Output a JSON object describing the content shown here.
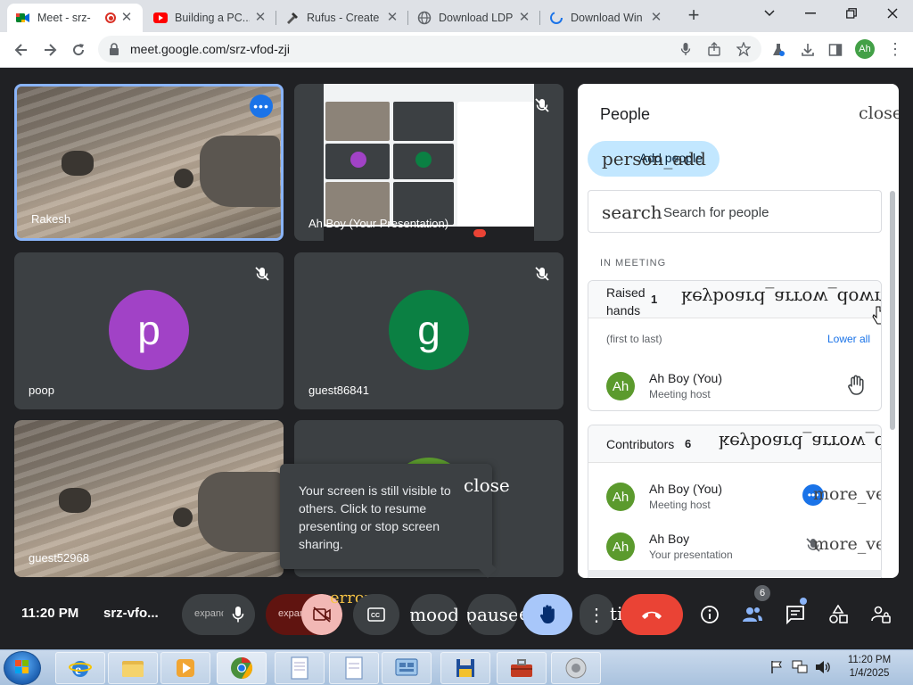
{
  "browser": {
    "tabs": [
      {
        "title": "Meet - srz-",
        "active": true
      },
      {
        "title": "Building a PC..."
      },
      {
        "title": "Rufus - Create"
      },
      {
        "title": "Download LDP"
      },
      {
        "title": "Download Win"
      }
    ],
    "url": "meet.google.com/srz-vfod-zji",
    "profile_initials": "Ah"
  },
  "tiles": {
    "rakesh": {
      "name": "Rakesh"
    },
    "presentation": {
      "name": "Ah Boy (Your Presentation)"
    },
    "poop": {
      "name": "poop",
      "initial": "p",
      "color": "#a142c6"
    },
    "guest86841": {
      "name": "guest86841",
      "initial": "g",
      "color": "#0b8043"
    },
    "guest52968": {
      "name": "guest52968"
    }
  },
  "toast": {
    "text": "Your screen is still visible to others. Click to resume presenting or stop screen sharing.",
    "close_glyph": "close"
  },
  "people_panel": {
    "title": "People",
    "close_glyph": "close",
    "add_icon": "person_add",
    "add_label": "Add people",
    "search_icon": "search",
    "search_placeholder": "Search for people",
    "section": "IN MEETING",
    "raised_hands": {
      "title_line1": "Raised",
      "title_line2": "hands",
      "count": "1",
      "chevron": "keyboard_arrow_down",
      "order_hint": "(first to last)",
      "lower_all": "Lower all",
      "person": {
        "initials": "Ah",
        "name": "Ah Boy (You)",
        "role": "Meeting host"
      }
    },
    "contributors": {
      "title": "Contributors",
      "count": "6",
      "chevron": "keyboard_arrow_down",
      "people": [
        {
          "initials": "Ah",
          "name": "Ah Boy (You)",
          "role": "Meeting host",
          "action": "more_vert"
        },
        {
          "initials": "Ah",
          "name": "Ah Boy",
          "role": "Your presentation",
          "action": "more_vert"
        }
      ]
    }
  },
  "controls": {
    "time": "11:20 PM",
    "meeting_code": "srz-vfo...",
    "mic_expand": "expand_less",
    "cam_expand": "expand_less",
    "cam_error": "error",
    "reactions": "mood",
    "present": "pause",
    "more_text": "ti",
    "people_badge": "6",
    "present_text": "e"
  },
  "taskbar": {
    "time": "11:20 PM",
    "date": "1/4/2025"
  },
  "colors": {
    "meet_bg": "#202124",
    "tile_bg": "#3c4043",
    "accent_blue": "#1a73e8",
    "end_call_red": "#ea4335",
    "hand_raise_active": "#a8c7fa",
    "add_people_bg": "#c2e7ff"
  }
}
